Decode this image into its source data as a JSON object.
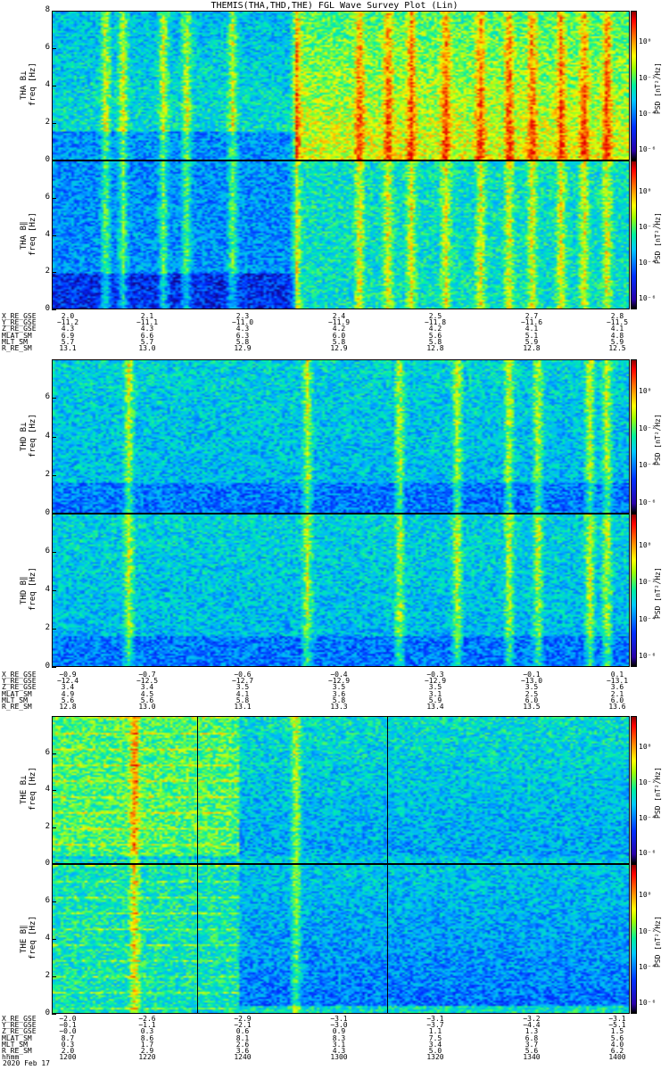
{
  "title": "THEMIS(THA,THD,THE) FGL Wave Survey Plot (Lin)",
  "colors": {
    "frame": "#000000"
  },
  "panels": [
    {
      "id": "tha-bl",
      "label_top": "THA B⊥",
      "label_bot": "freq [Hz]",
      "cbar_title": "PSD [nT²/Hz]",
      "yticks": [
        "0",
        "2",
        "4",
        "6",
        "8"
      ],
      "ylim": [
        0,
        8
      ],
      "cbar_ticks": [
        "10⁰",
        "10⁻²",
        "10⁻⁴",
        "10⁻⁶"
      ],
      "intensity": "high",
      "seed": 11,
      "bursts": [
        0.09,
        0.12,
        0.19,
        0.23,
        0.31,
        0.42,
        0.53,
        0.58,
        0.62,
        0.68,
        0.74,
        0.79,
        0.83,
        0.88,
        0.92,
        0.96
      ],
      "split": 0.42
    },
    {
      "id": "tha-bp",
      "label_top": "THA B∥",
      "label_bot": "freq [Hz]",
      "cbar_title": "PSD [nT²/Hz]",
      "yticks": [
        "0",
        "2",
        "4",
        "6"
      ],
      "ylim": [
        0,
        8
      ],
      "cbar_ticks": [
        "10⁰",
        "10⁻²",
        "10⁻⁴",
        "10⁻⁶"
      ],
      "intensity": "mid",
      "seed": 23,
      "bursts": [
        0.09,
        0.12,
        0.19,
        0.23,
        0.31,
        0.42,
        0.53,
        0.58,
        0.62,
        0.68,
        0.74,
        0.79,
        0.83,
        0.88,
        0.92,
        0.96
      ],
      "split": 0.42
    },
    {
      "id": "thd-bl",
      "label_top": "THD B⊥",
      "label_bot": "freq [Hz]",
      "cbar_title": "PSD [nT²/Hz]",
      "yticks": [
        "0",
        "2",
        "4",
        "6"
      ],
      "ylim": [
        0,
        8
      ],
      "cbar_ticks": [
        "10⁰",
        "10⁻²",
        "10⁻⁴",
        "10⁻⁶"
      ],
      "intensity": "low",
      "seed": 37,
      "bursts": [
        0.13,
        0.44,
        0.6,
        0.7,
        0.79,
        0.84,
        0.93,
        0.96
      ],
      "split": 0.0
    },
    {
      "id": "thd-bp",
      "label_top": "THD B∥",
      "label_bot": "freq [Hz]",
      "cbar_title": "PSD [nT²/Hz]",
      "yticks": [
        "0",
        "2",
        "4",
        "6"
      ],
      "ylim": [
        0,
        8
      ],
      "cbar_ticks": [
        "10⁰",
        "10⁻²",
        "10⁻⁴",
        "10⁻⁶"
      ],
      "intensity": "low",
      "seed": 41,
      "bursts": [
        0.13,
        0.44,
        0.6,
        0.7,
        0.79,
        0.84,
        0.93,
        0.96
      ],
      "split": 0.0
    },
    {
      "id": "the-bl",
      "label_top": "THE B⊥",
      "label_bot": "freq [Hz]",
      "cbar_title": "PSD [nT²/Hz]",
      "yticks": [
        "0",
        "2",
        "4",
        "6"
      ],
      "ylim": [
        0,
        8
      ],
      "cbar_ticks": [
        "10⁰",
        "10⁻²",
        "10⁻⁴",
        "10⁻⁶"
      ],
      "intensity": "the",
      "seed": 53,
      "bursts": [
        0.14,
        0.42
      ],
      "split": 0.32,
      "marks": [
        0.25,
        0.58
      ]
    },
    {
      "id": "the-bp",
      "label_top": "THE B∥",
      "label_bot": "freq [Hz]",
      "cbar_title": "PSD [nT²/Hz]",
      "yticks": [
        "0",
        "2",
        "4",
        "6"
      ],
      "ylim": [
        0,
        8
      ],
      "cbar_ticks": [
        "10⁰",
        "10⁻²",
        "10⁻⁴",
        "10⁻⁶"
      ],
      "intensity": "the2",
      "seed": 67,
      "bursts": [
        0.14,
        0.42
      ],
      "split": 0.32,
      "marks": [
        0.25,
        0.58
      ]
    }
  ],
  "eph": [
    {
      "names": [
        "X_RE_GSE",
        "Y_RE_GSE",
        "Z_RE_GSE",
        "MLAT_SM",
        "MLT_SM",
        "R_RE_SM"
      ],
      "cols": [
        [
          "2.0",
          "−11.2",
          "4.3",
          "6.9",
          "5.7",
          "13.1"
        ],
        [
          "2.1",
          "−11.1",
          "4.3",
          "6.6",
          "5.7",
          "13.0"
        ],
        [
          "2.3",
          "−11.0",
          "4.3",
          "6.3",
          "5.8",
          "12.9"
        ],
        [
          "2.4",
          "−11.9",
          "4.2",
          "6.0",
          "5.8",
          "12.9"
        ],
        [
          "2.5",
          "−11.8",
          "4.2",
          "5.6",
          "5.8",
          "12.8"
        ],
        [
          "2.7",
          "−11.6",
          "4.1",
          "5.1",
          "5.9",
          "12.8"
        ],
        [
          "2.8",
          "−11.5",
          "4.1",
          "4.8",
          "5.9",
          "12.5"
        ]
      ]
    },
    {
      "names": [
        "X_RE_GSE",
        "Y_RE_GSE",
        "Z_RE_GSE",
        "MLAT_SM",
        "MLT_SM",
        "R_RE_SM"
      ],
      "cols": [
        [
          "−0.9",
          "−12.4",
          "3.4",
          "4.9",
          "5.6",
          "12.8"
        ],
        [
          "−0.7",
          "−12.5",
          "3.4",
          "4.5",
          "5.6",
          "13.0"
        ],
        [
          "−0.6",
          "−12.7",
          "3.5",
          "4.1",
          "5.8",
          "13.1"
        ],
        [
          "−0.4",
          "−12.9",
          "3.5",
          "3.6",
          "5.8",
          "13.3"
        ],
        [
          "−0.3",
          "−12.9",
          "3.5",
          "3.1",
          "5.9",
          "13.4"
        ],
        [
          "−0.1",
          "−13.0",
          "3.5",
          "2.5",
          "6.0",
          "13.5"
        ],
        [
          "0.1",
          "−13.1",
          "3.6",
          "2.1",
          "6.0",
          "13.6"
        ]
      ]
    },
    {
      "names": [
        "X_RE_GSE",
        "Y_RE_GSE",
        "Z_RE_GSE",
        "MLAT_SM",
        "MLT_SM",
        "R_RE_SM",
        "hhmm"
      ],
      "cols": [
        [
          "−2.0",
          "−0.1",
          "−0.0",
          "8.7",
          "0.3",
          "2.0",
          "1200"
        ],
        [
          "−2.6",
          "−1.1",
          "0.3",
          "8.6",
          "1.7",
          "2.9",
          "1220"
        ],
        [
          "−2.9",
          "−2.1",
          "0.6",
          "8.1",
          "2.6",
          "3.6",
          "1240"
        ],
        [
          "−3.1",
          "−3.0",
          "0.9",
          "8.3",
          "3.1",
          "4.3",
          "1300"
        ],
        [
          "−3.1",
          "−3.7",
          "1.1",
          "7.5",
          "3.4",
          "5.0",
          "1320"
        ],
        [
          "−3.2",
          "−4.4",
          "1.3",
          "6.8",
          "3.7",
          "5.6",
          "1340"
        ],
        [
          "−3.1",
          "−5.1",
          "1.5",
          "5.6",
          "4.0",
          "6.2",
          "1400"
        ]
      ]
    }
  ],
  "date": "2020 Feb 17"
}
